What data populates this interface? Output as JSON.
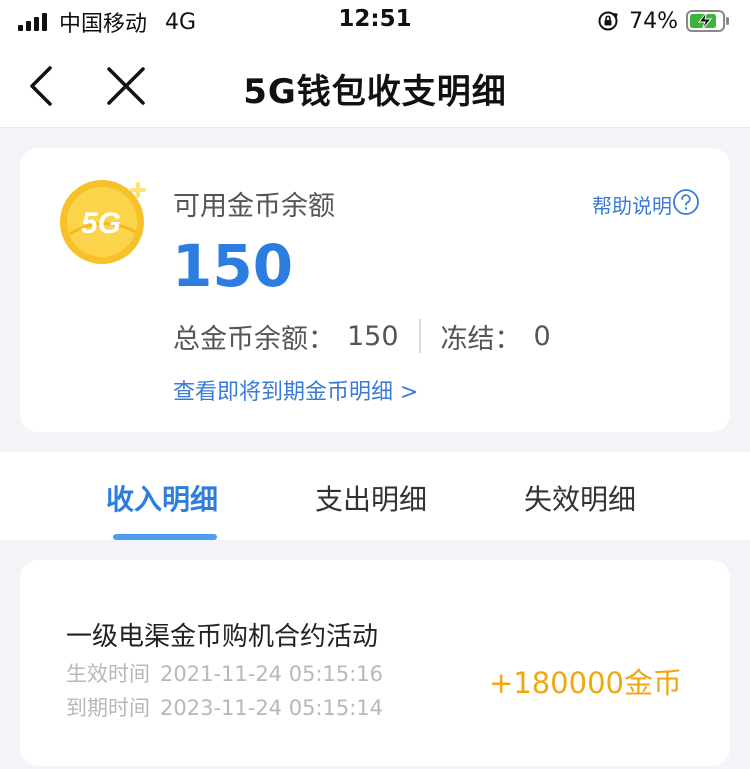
{
  "status_bar": {
    "carrier": "中国移动",
    "network": "4G",
    "time": "12:51",
    "battery_percent": "74%"
  },
  "nav": {
    "title": "5G钱包收支明细"
  },
  "balance": {
    "available_label": "可用金币余额",
    "help_label": "帮助说明",
    "available_value": "150",
    "total_label": "总金币余额：",
    "total_value": "150",
    "frozen_label": "冻结：",
    "frozen_value": "0",
    "expiring_link": "查看即将到期金币明细 >",
    "coin_text": "5G"
  },
  "tabs": [
    {
      "label": "收入明细",
      "active": true
    },
    {
      "label": "支出明细",
      "active": false
    },
    {
      "label": "失效明细",
      "active": false
    }
  ],
  "records": [
    {
      "title": "一级电渠金币购机合约活动",
      "effective_label": "生效时间",
      "effective_time": "2021-11-24 05:15:16",
      "expire_label": "到期时间",
      "expire_time": "2023-11-24 05:15:14",
      "amount": "+180000金币"
    }
  ],
  "colors": {
    "accent": "#2d7de1",
    "link": "#3a7bd5",
    "amount": "#f0a80e",
    "coin": "#f7c12a",
    "battery_charging": "#3cb43c"
  },
  "icons": {
    "back": "chevron-left-icon",
    "close": "close-icon",
    "help": "question-circle-icon",
    "coin": "5g-coin-icon",
    "orientation_lock": "orientation-lock-icon",
    "battery": "battery-charging-icon"
  }
}
